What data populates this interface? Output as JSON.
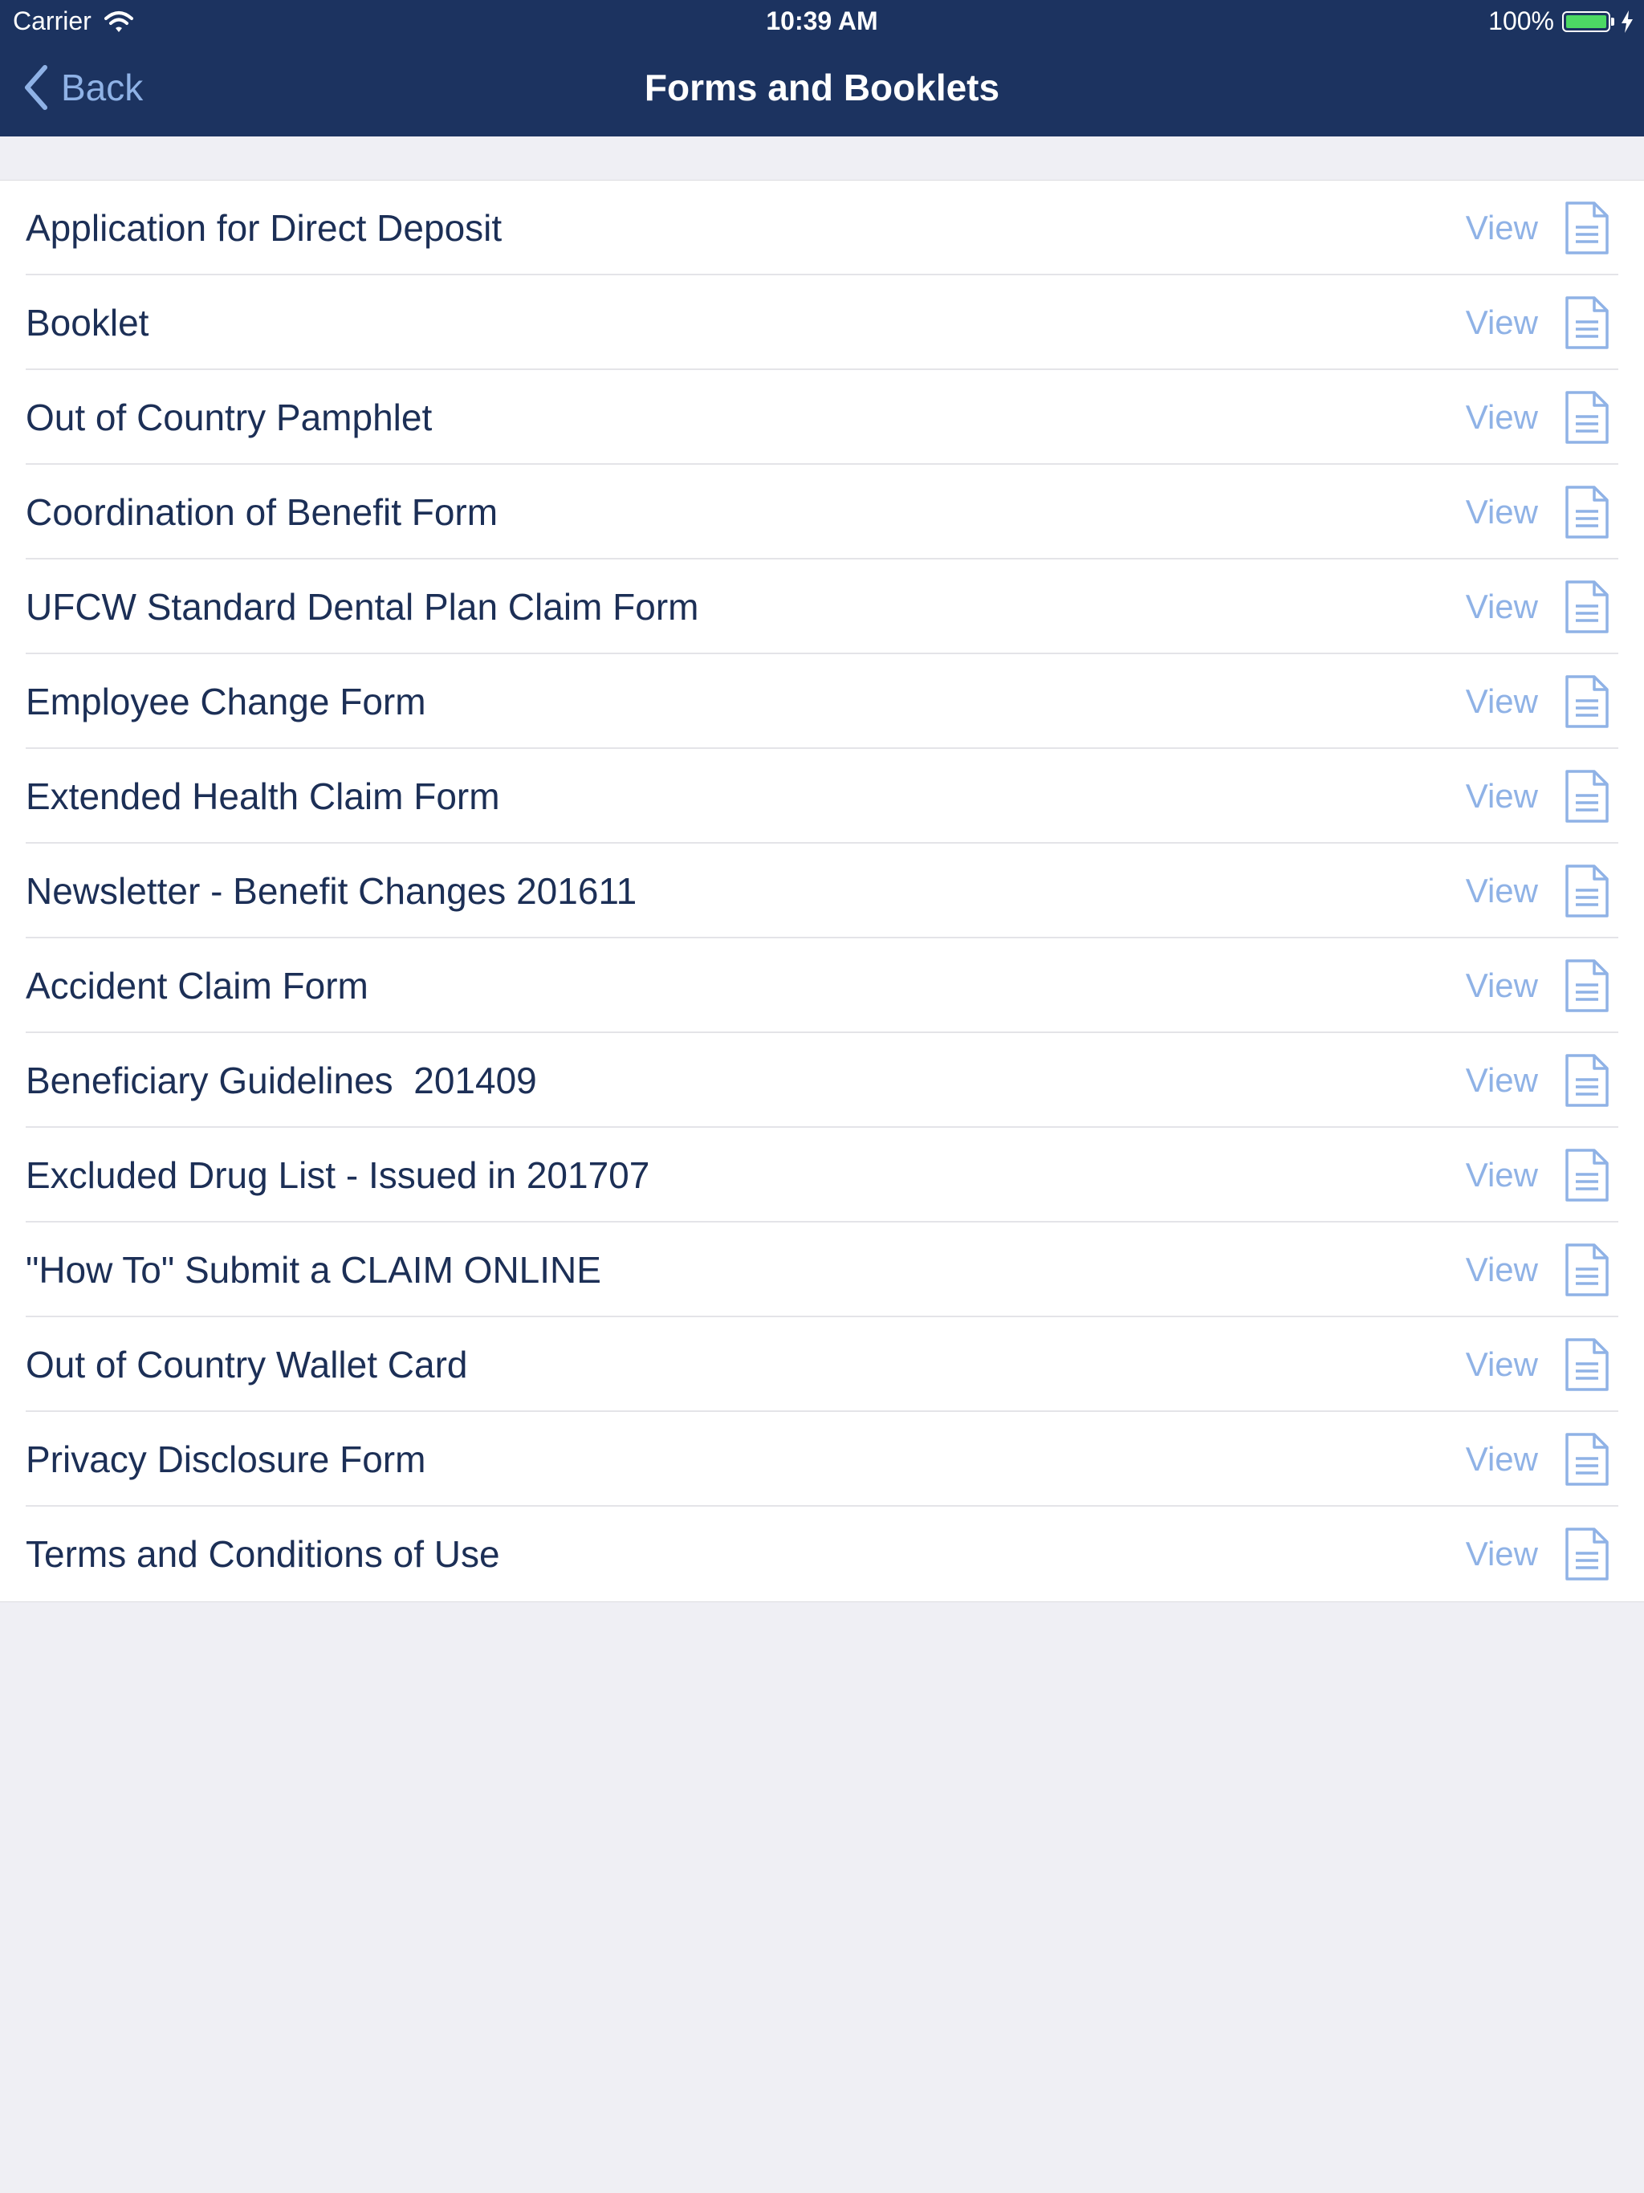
{
  "status_bar": {
    "carrier": "Carrier",
    "time": "10:39 AM",
    "battery_percent": "100%",
    "battery_level": 1.0,
    "icons": [
      "wifi-icon",
      "battery-icon",
      "charging-bolt-icon"
    ]
  },
  "nav": {
    "back_label": "Back",
    "title": "Forms and Booklets"
  },
  "colors": {
    "header_bg": "#1c3360",
    "accent": "#8fb2e6",
    "text_dark": "#1c2f56",
    "page_bg": "#efeff4",
    "battery_green": "#4cd964"
  },
  "list": {
    "view_label": "View",
    "row_icon": "document-icon",
    "items": [
      {
        "label": "Application for Direct Deposit"
      },
      {
        "label": "Booklet"
      },
      {
        "label": "Out of Country Pamphlet"
      },
      {
        "label": "Coordination of Benefit Form"
      },
      {
        "label": "UFCW Standard Dental Plan Claim Form"
      },
      {
        "label": "Employee Change Form"
      },
      {
        "label": "Extended Health Claim Form"
      },
      {
        "label": "Newsletter - Benefit Changes 201611"
      },
      {
        "label": "Accident Claim Form"
      },
      {
        "label": "Beneficiary Guidelines  201409"
      },
      {
        "label": "Excluded Drug List - Issued in 201707"
      },
      {
        "label": "\"How To\" Submit a CLAIM ONLINE"
      },
      {
        "label": "Out of Country Wallet Card"
      },
      {
        "label": "Privacy Disclosure Form"
      },
      {
        "label": "Terms and Conditions of Use"
      }
    ]
  }
}
